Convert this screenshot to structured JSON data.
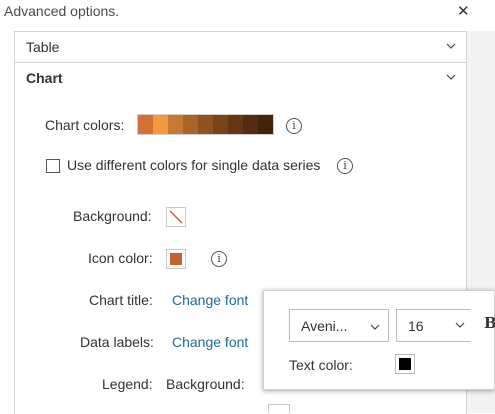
{
  "dialog": {
    "title": "Advanced options.",
    "close_icon": "close-icon"
  },
  "sections": {
    "table_label": "Table",
    "chart_label": "Chart"
  },
  "chart": {
    "chart_colors_label": "Chart colors:",
    "ramp_colors": [
      "#d46f35",
      "#f39a3c",
      "#c77a36",
      "#a9642a",
      "#8f5220",
      "#7a4419",
      "#673714",
      "#552c0f",
      "#45220a"
    ],
    "different_colors_label": "Use different colors for single data series",
    "different_colors_checked": false,
    "background_label": "Background:",
    "icon_color_label": "Icon color:",
    "icon_color": "#c9652b",
    "chart_title_label": "Chart title:",
    "data_labels_label": "Data labels:",
    "change_font_label": "Change font",
    "legend_label": "Legend:",
    "legend_background_label": "Background:"
  },
  "font_popup": {
    "font_family": "Aveni...",
    "font_size": "16",
    "bold_label": "B",
    "text_color_label": "Text color:",
    "text_color": "#000000"
  }
}
